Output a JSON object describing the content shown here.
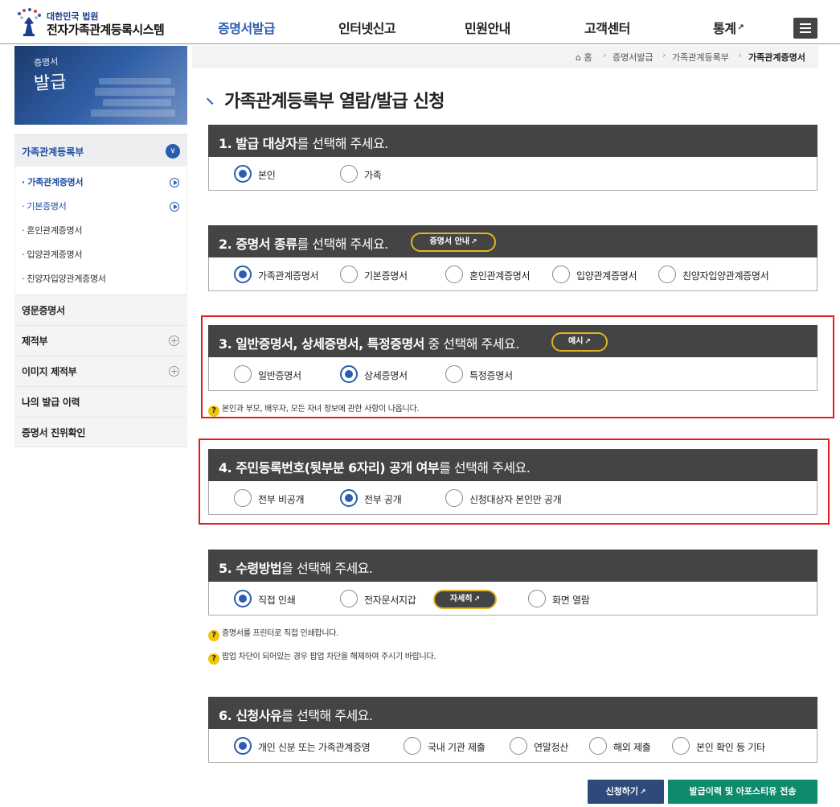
{
  "header": {
    "logo_sub": "대한민국 법원",
    "logo_main": "전자가족관계등록시스템",
    "nav": [
      {
        "label": "증명서발급",
        "active": true
      },
      {
        "label": "인터넷신고"
      },
      {
        "label": "민원안내"
      },
      {
        "label": "고객센터"
      },
      {
        "label": "통계",
        "external": true
      }
    ],
    "menu_icon": "hamburger-icon",
    "external_icon": "↗"
  },
  "sidebar": {
    "banner_small": "증명서",
    "banner_large": "발급",
    "group_title": "가족관계등록부",
    "sub_items": [
      {
        "label": "· 가족관계증명서",
        "active": true
      },
      {
        "label": "· 기본증명서"
      },
      {
        "label": "· 혼인관계증명서"
      },
      {
        "label": "· 입양관계증명서"
      },
      {
        "label": "· 친양자입양관계증명서"
      }
    ],
    "items": [
      {
        "label": "영문증명서"
      },
      {
        "label": "제적부",
        "plus": "+"
      },
      {
        "label": "이미지 제적부",
        "plus": "+"
      },
      {
        "label": "나의 발급 이력"
      },
      {
        "label": "증명서 진위확인"
      }
    ]
  },
  "breadcrumb": {
    "home": "⌂ 홈",
    "sep": "›",
    "items": [
      "증명서발급",
      "가족관계등록부",
      "가족관계증명서"
    ]
  },
  "page_title": "가족관계등록부 열람/발급 신청",
  "sections": {
    "s1": {
      "num": "1. ",
      "bold": "발급 대상자",
      "rest": "를 선택해 주세요.",
      "options": [
        "본인",
        "가족"
      ],
      "selected": 0
    },
    "s2": {
      "num": "2. ",
      "bold": "증명서 종류",
      "rest": "를 선택해 주세요.",
      "pill": "증명서 안내",
      "options": [
        "가족관계증명서",
        "기본증명서",
        "혼인관계증명서",
        "입양관계증명서",
        "친양자입양관계증명서"
      ],
      "selected": 0
    },
    "s3": {
      "num": "3. ",
      "bold": "일반증명서, 상세증명서, 특정증명서",
      "rest": " 중 선택해 주세요.",
      "pill": "예시",
      "options": [
        "일반증명서",
        "상세증명서",
        "특정증명서"
      ],
      "selected": 1,
      "help": "본인과 부모, 배우자, 모든 자녀 정보에 관한 사항이 나옵니다."
    },
    "s4": {
      "num": "4. ",
      "bold": "주민등록번호(뒷부분 6자리) 공개 여부",
      "rest": "를 선택해 주세요.",
      "options": [
        "전부 비공개",
        "전부 공개",
        "신청대상자 본인만 공개"
      ],
      "selected": 1
    },
    "s5": {
      "num": "5. ",
      "bold": "수령방법",
      "rest": "을 선택해 주세요.",
      "pill": "자세히",
      "options": [
        "직접 인쇄",
        "전자문서지갑",
        "화면 열람"
      ],
      "selected": 0,
      "help1": "증명서를 프린터로 직접 인쇄합니다.",
      "help2": "팝업 차단이 되어있는 경우 팝업 차단을 해제하여 주시기 바랍니다."
    },
    "s6": {
      "num": "6. ",
      "bold": "신청사유",
      "rest": "를 선택해 주세요.",
      "options": [
        "개인 신분 또는 가족관계증명",
        "국내 기관 제출",
        "연말정산",
        "해외 제출",
        "본인 확인 등 기타"
      ],
      "selected": 0
    }
  },
  "help_icon": "?",
  "buttons": {
    "apply": "신청하기",
    "history": "발급이력 및 아포스티유 전송"
  },
  "colors": {
    "accent": "#2b5cad",
    "section_header": "#444444",
    "highlight": "#e21b1b",
    "pill_border": "#e0b521",
    "history_button": "#0e8a6d",
    "apply_button": "#2d4a7a"
  }
}
